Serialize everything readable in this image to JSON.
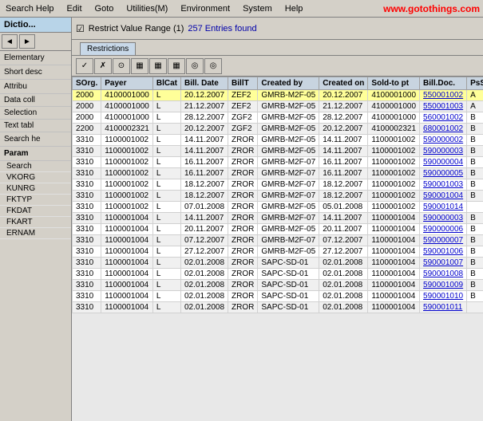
{
  "menuBar": {
    "items": [
      "Search Help",
      "Edit",
      "Goto",
      "Utilities(M)",
      "Environment",
      "System",
      "Help"
    ],
    "brand": "www.gotothings.com"
  },
  "sidebar": {
    "header": "Dictio...",
    "navButtons": [
      "◄",
      "►"
    ],
    "sections": [
      {
        "label": "Elementary",
        "type": "section"
      },
      {
        "label": "Short desc",
        "type": "section"
      },
      {
        "label": "Attribu",
        "type": "section"
      },
      {
        "label": "Data coll",
        "type": "item"
      },
      {
        "label": "Selection",
        "type": "item"
      },
      {
        "label": "Text tabl",
        "type": "item"
      }
    ],
    "searchLabel": "Search he",
    "paramLabel": "Param",
    "paramItems": [
      "Search",
      "VKORG",
      "KUNRG",
      "FKTYP",
      "FKDAT",
      "FKART",
      "ERNAM"
    ]
  },
  "topBar": {
    "restrictText": "Restrict Value Range (1)",
    "countText": "257 Entries found",
    "tabLabel": "Restrictions"
  },
  "toolbar": {
    "buttons": [
      "✓",
      "✗",
      "◉",
      "⬛",
      "⬛",
      "⬛",
      "◎",
      "◎"
    ]
  },
  "table": {
    "columns": [
      "SOrg.",
      "Payer",
      "BlCat",
      "Bill. Date",
      "BillT",
      "Created by",
      "Created on",
      "Sold-to pt",
      "Bill.Doc.",
      "PsSt"
    ],
    "rows": [
      {
        "sorg": "2000",
        "payer": "4100001000",
        "blcat": "L",
        "billdate": "20.12.2007",
        "billt": "ZEF2",
        "createdby": "GMRB-M2F-05",
        "createdon": "20.12.2007",
        "soldtopt": "4100001000",
        "billdoc": "550001002",
        "psst": "A",
        "highlight": true
      },
      {
        "sorg": "2000",
        "payer": "4100001000",
        "blcat": "L",
        "billdate": "21.12.2007",
        "billt": "ZEF2",
        "createdby": "GMRB-M2F-05",
        "createdon": "21.12.2007",
        "soldtopt": "4100001000",
        "billdoc": "550001003",
        "psst": "A"
      },
      {
        "sorg": "2000",
        "payer": "4100001000",
        "blcat": "L",
        "billdate": "28.12.2007",
        "billt": "ZGF2",
        "createdby": "GMRB-M2F-05",
        "createdon": "28.12.2007",
        "soldtopt": "4100001000",
        "billdoc": "560001002",
        "psst": "B"
      },
      {
        "sorg": "2200",
        "payer": "4100002321",
        "blcat": "L",
        "billdate": "20.12.2007",
        "billt": "ZGF2",
        "createdby": "GMRB-M2F-05",
        "createdon": "20.12.2007",
        "soldtopt": "4100002321",
        "billdoc": "680001002",
        "psst": "B"
      },
      {
        "sorg": "3310",
        "payer": "1100001002",
        "blcat": "L",
        "billdate": "14.11.2007",
        "billt": "ZROR",
        "createdby": "GMRB-M2F-05",
        "createdon": "14.11.2007",
        "soldtopt": "1100001002",
        "billdoc": "590000002",
        "psst": "B"
      },
      {
        "sorg": "3310",
        "payer": "1100001002",
        "blcat": "L",
        "billdate": "14.11.2007",
        "billt": "ZROR",
        "createdby": "GMRB-M2F-05",
        "createdon": "14.11.2007",
        "soldtopt": "1100001002",
        "billdoc": "590000003",
        "psst": "B"
      },
      {
        "sorg": "3310",
        "payer": "1100001002",
        "blcat": "L",
        "billdate": "16.11.2007",
        "billt": "ZROR",
        "createdby": "GMRB-M2F-07",
        "createdon": "16.11.2007",
        "soldtopt": "1100001002",
        "billdoc": "590000004",
        "psst": "B"
      },
      {
        "sorg": "3310",
        "payer": "1100001002",
        "blcat": "L",
        "billdate": "16.11.2007",
        "billt": "ZROR",
        "createdby": "GMRB-M2F-07",
        "createdon": "16.11.2007",
        "soldtopt": "1100001002",
        "billdoc": "590000005",
        "psst": "B"
      },
      {
        "sorg": "3310",
        "payer": "1100001002",
        "blcat": "L",
        "billdate": "18.12.2007",
        "billt": "ZROR",
        "createdby": "GMRB-M2F-07",
        "createdon": "18.12.2007",
        "soldtopt": "1100001002",
        "billdoc": "590001003",
        "psst": "B"
      },
      {
        "sorg": "3310",
        "payer": "1100001002",
        "blcat": "L",
        "billdate": "18.12.2007",
        "billt": "ZROR",
        "createdby": "GMRB-M2F-07",
        "createdon": "18.12.2007",
        "soldtopt": "1100001002",
        "billdoc": "590001004",
        "psst": "B"
      },
      {
        "sorg": "3310",
        "payer": "1100001002",
        "blcat": "L",
        "billdate": "07.01.2008",
        "billt": "ZROR",
        "createdby": "GMRB-M2F-05",
        "createdon": "05.01.2008",
        "soldtopt": "1100001002",
        "billdoc": "590001014",
        "psst": ""
      },
      {
        "sorg": "3310",
        "payer": "1100001004",
        "blcat": "L",
        "billdate": "14.11.2007",
        "billt": "ZROR",
        "createdby": "GMRB-M2F-07",
        "createdon": "14.11.2007",
        "soldtopt": "1100001004",
        "billdoc": "590000003",
        "psst": "B"
      },
      {
        "sorg": "3310",
        "payer": "1100001004",
        "blcat": "L",
        "billdate": "20.11.2007",
        "billt": "ZROR",
        "createdby": "GMRB-M2F-05",
        "createdon": "20.11.2007",
        "soldtopt": "1100001004",
        "billdoc": "590000006",
        "psst": "B"
      },
      {
        "sorg": "3310",
        "payer": "1100001004",
        "blcat": "L",
        "billdate": "07.12.2007",
        "billt": "ZROR",
        "createdby": "GMRB-M2F-07",
        "createdon": "07.12.2007",
        "soldtopt": "1100001004",
        "billdoc": "590000007",
        "psst": "B"
      },
      {
        "sorg": "3310",
        "payer": "1100001004",
        "blcat": "L",
        "billdate": "27.12.2007",
        "billt": "ZROR",
        "createdby": "GMRB-M2F-05",
        "createdon": "27.12.2007",
        "soldtopt": "1100001004",
        "billdoc": "590001006",
        "psst": "B"
      },
      {
        "sorg": "3310",
        "payer": "1100001004",
        "blcat": "L",
        "billdate": "02.01.2008",
        "billt": "ZROR",
        "createdby": "SAPC-SD-01",
        "createdon": "02.01.2008",
        "soldtopt": "1100001004",
        "billdoc": "590001007",
        "psst": "B"
      },
      {
        "sorg": "3310",
        "payer": "1100001004",
        "blcat": "L",
        "billdate": "02.01.2008",
        "billt": "ZROR",
        "createdby": "SAPC-SD-01",
        "createdon": "02.01.2008",
        "soldtopt": "1100001004",
        "billdoc": "590001008",
        "psst": "B"
      },
      {
        "sorg": "3310",
        "payer": "1100001004",
        "blcat": "L",
        "billdate": "02.01.2008",
        "billt": "ZROR",
        "createdby": "SAPC-SD-01",
        "createdon": "02.01.2008",
        "soldtopt": "1100001004",
        "billdoc": "590001009",
        "psst": "B"
      },
      {
        "sorg": "3310",
        "payer": "1100001004",
        "blcat": "L",
        "billdate": "02.01.2008",
        "billt": "ZROR",
        "createdby": "SAPC-SD-01",
        "createdon": "02.01.2008",
        "soldtopt": "1100001004",
        "billdoc": "590001010",
        "psst": "B"
      },
      {
        "sorg": "3310",
        "payer": "1100001004",
        "blcat": "L",
        "billdate": "02.01.2008",
        "billt": "ZROR",
        "createdby": "SAPC-SD-01",
        "createdon": "02.01.2008",
        "soldtopt": "1100001004",
        "billdoc": "590001011",
        "psst": ""
      }
    ]
  }
}
